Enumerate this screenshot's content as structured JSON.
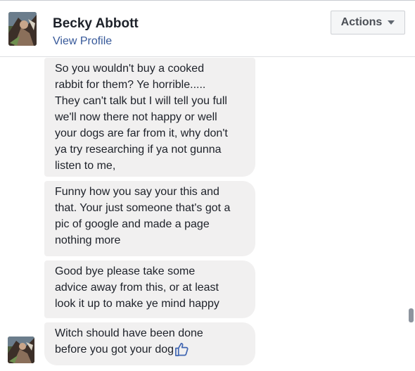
{
  "header": {
    "name": "Becky Abbott",
    "view_profile": "View Profile",
    "actions_label": "Actions",
    "actions_icon": "caret-down-icon"
  },
  "messages": [
    {
      "lines": [
        "So you wouldn't buy a cooked",
        "rabbit for them? Ye horrible.....",
        "They can't talk but I will tell you full",
        "we'll now there not happy or well",
        "your dogs are far from it, why don't",
        "ya try researching if ya not gunna",
        "listen to me,"
      ]
    },
    {
      "lines": [
        "Funny how you say your this and",
        "that. Your just someone that's got a",
        "pic of google and made a page",
        "nothing more"
      ]
    },
    {
      "lines": [
        "Good bye please take some",
        "advice away from this, or at least",
        "look it up to make ye mind happy"
      ]
    },
    {
      "lines": [
        "Witch should have been done",
        "before you got your dog"
      ],
      "trailing_icon": "thumbs-up-icon"
    }
  ],
  "colors": {
    "bubble_bg": "#f1f0f0",
    "link": "#365899",
    "text": "#1d2129",
    "thumb": "#4267b2"
  }
}
